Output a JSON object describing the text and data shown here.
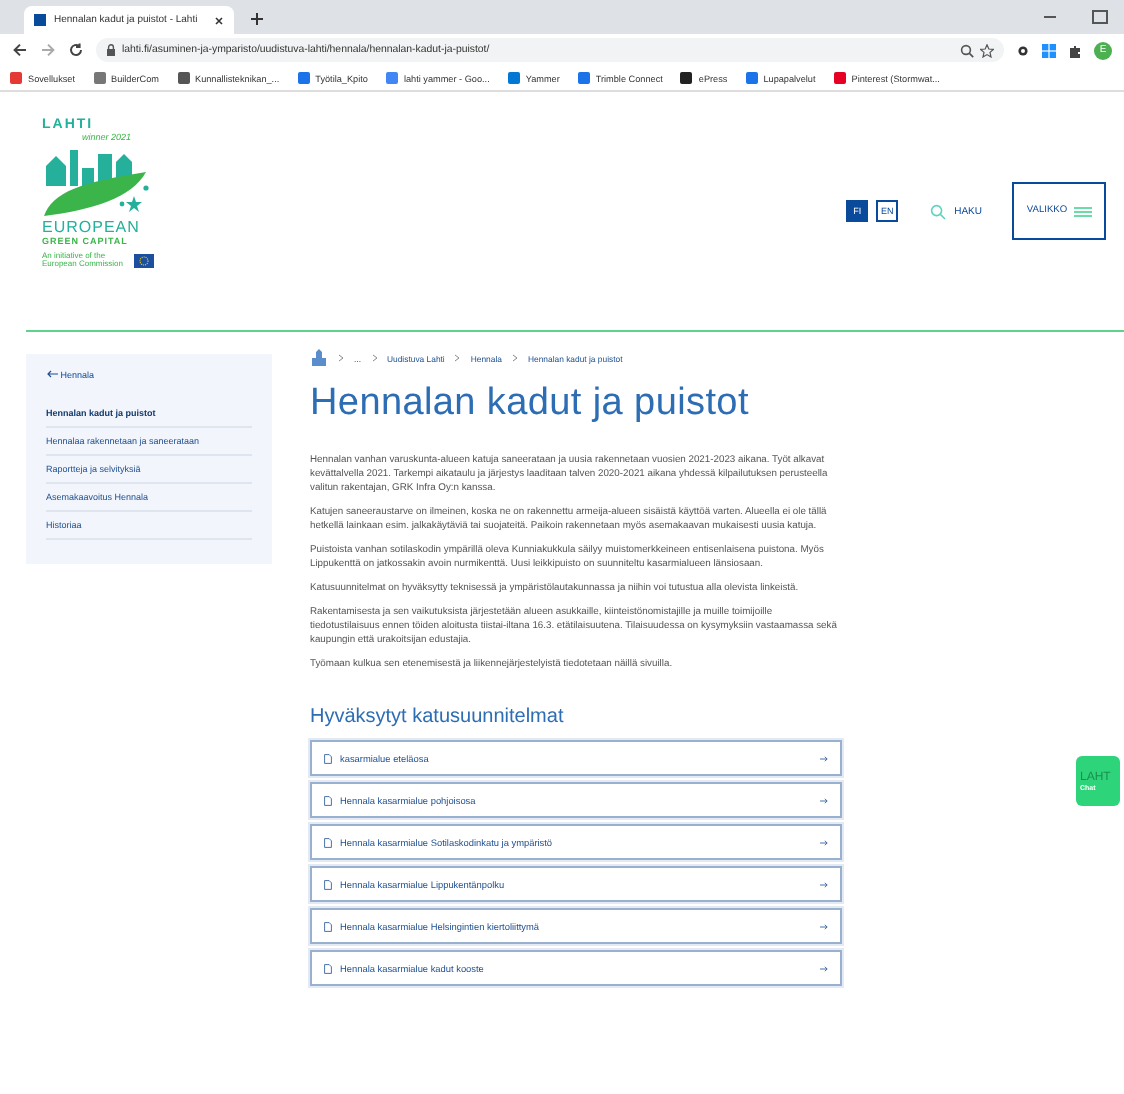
{
  "browser": {
    "tab_title": "Hennalan kadut ja puistot - Lahti",
    "url": "lahti.fi/asuminen-ja-ymparisto/uudistuva-lahti/hennala/hennalan-kadut-ja-puistot/",
    "avatar": "E",
    "bookmarks": [
      {
        "label": "Sovellukset"
      },
      {
        "label": "BuilderCom"
      },
      {
        "label": "Kunnallisteknikan_..."
      },
      {
        "label": "Työtila_Kpito"
      },
      {
        "label": "lahti yammer - Goo..."
      },
      {
        "label": "Yammer"
      },
      {
        "label": "Trimble Connect"
      },
      {
        "label": "ePress"
      },
      {
        "label": "Lupapalvelut"
      },
      {
        "label": "Pinterest (Stormwat..."
      }
    ]
  },
  "logo": {
    "city": "LAHTI",
    "tagline": "winner 2021",
    "line1": "EUROPEAN",
    "line2": "GREEN CAPITAL",
    "initiative": "An initiative of the European Commission"
  },
  "languages": [
    {
      "label": "FI",
      "selected": true
    },
    {
      "label": "EN",
      "selected": false
    }
  ],
  "search_label": "HAKU",
  "menu_label": "VALIKKO",
  "sidebar": {
    "back": "Hennala",
    "items": [
      {
        "label": "Hennalan kadut ja puistot",
        "selected": true
      },
      {
        "label": "Hennalaa rakennetaan ja saneerataan",
        "selected": false
      },
      {
        "label": "Raportteja ja selvityksiä",
        "selected": false
      },
      {
        "label": "Asemakaavoitus Hennala",
        "selected": false
      },
      {
        "label": "Historiaa",
        "selected": false
      }
    ]
  },
  "breadcrumb": [
    "...",
    "Uudistuva Lahti",
    "Hennala",
    "Hennalan kadut ja puistot"
  ],
  "title": "Hennalan kadut ja puistot",
  "paragraphs": [
    "Hennalan vanhan varuskunta-alueen katuja saneerataan ja uusia rakennetaan vuosien 2021-2023 aikana. Työt alkavat kevättalvella 2021. Tarkempi aikataulu ja järjestys laaditaan talven 2020-2021 aikana yhdessä kilpailutuksen perusteella valitun rakentajan,  GRK Infra Oy:n  kanssa.",
    "Katujen saneeraustarve on ilmeinen, koska ne on rakennettu armeija-alueen sisäistä käyttöä varten. Alueella ei ole tällä hetkellä lainkaan esim. jalkakäytäviä tai suojateitä. Paikoin rakennetaan myös asemakaavan mukaisesti uusia katuja.",
    "Puistoista vanhan sotilaskodin ympärillä oleva Kunniakukkula säilyy muistomerkkeineen entisenlaisena puistona. Myös Lippukenttä on jatkossakin avoin nurmikenttä. Uusi leikkipuisto on suunniteltu kasarmialueen länsiosaan.",
    "Katusuunnitelmat on hyväksytty teknisessä ja ympäristölautakunnassa ja niihin voi tutustua alla olevista linkeistä.",
    "Rakentamisesta ja sen vaikutuksista  järjestetään alueen asukkaille, kiinteistönomistajille ja muille toimijoille tiedotustilaisuus ennen töiden aloitusta tiistai-iltana 16.3. etätilaisuutena. Tilaisuudessa on kysymyksiin vastaamassa sekä kaupungin että urakoitsijan edustajia.",
    "Työmaan kulkua sen etenemisestä ja liikennejärjestelyistä tiedotetaan näillä sivuilla."
  ],
  "section_title": "Hyväksytyt katusuunnitelmat",
  "documents": [
    "kasarmialue eteläosa",
    "Hennala kasarmialue pohjoisosa",
    "Hennala kasarmialue Sotilaskodinkatu ja ympäristö",
    "Hennala kasarmialue Lippukentänpolku",
    "Hennala kasarmialue Helsingintien kiertoliittymä",
    "Hennala kasarmialue kadut kooste"
  ],
  "chat": {
    "brand": "LAHT",
    "label": "Chat"
  }
}
